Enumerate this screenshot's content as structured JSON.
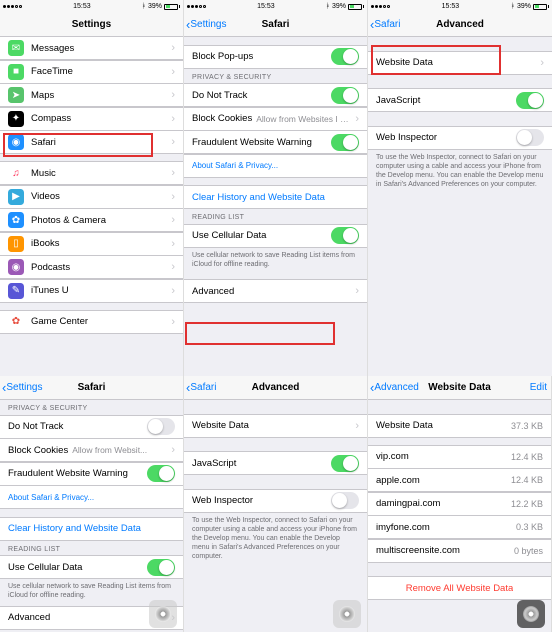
{
  "status": {
    "carrier": "",
    "time": "15:53",
    "battery": "39%"
  },
  "p1": {
    "title": "Settings",
    "items": [
      {
        "label": "Messages",
        "color": "#4cd964",
        "glyph": "✉"
      },
      {
        "label": "FaceTime",
        "color": "#4cd964",
        "glyph": "■"
      },
      {
        "label": "Maps",
        "color": "#58c46c",
        "glyph": "➤"
      },
      {
        "label": "Compass",
        "color": "#000",
        "glyph": "✦"
      },
      {
        "label": "Safari",
        "color": "#1e90ff",
        "glyph": "◉",
        "hi": true
      }
    ],
    "items2": [
      {
        "label": "Music",
        "color": "#fff",
        "glyph": "♫",
        "fg": "#ff2d55"
      },
      {
        "label": "Videos",
        "color": "#34aadc",
        "glyph": "▶"
      },
      {
        "label": "Photos & Camera",
        "color": "#1e90ff",
        "glyph": "✿"
      },
      {
        "label": "iBooks",
        "color": "#ff9500",
        "glyph": "▯"
      },
      {
        "label": "Podcasts",
        "color": "#9b59b6",
        "glyph": "◉"
      },
      {
        "label": "iTunes U",
        "color": "#5856d6",
        "glyph": "✎"
      }
    ],
    "items3": [
      {
        "label": "Game Center",
        "color": "#fff",
        "glyph": "✿",
        "fg": "#e74c3c"
      }
    ]
  },
  "p2": {
    "back": "Settings",
    "title": "Safari",
    "block_popups": "Block Pop-ups",
    "sec_header": "PRIVACY & SECURITY",
    "do_not_track": "Do Not Track",
    "block_cookies": "Block Cookies",
    "block_cookies_val": "Allow from Websites I Visit",
    "fraud": "Fraudulent Website Warning",
    "about": "About Safari & Privacy...",
    "clear": "Clear History and Website Data",
    "rl_header": "READING LIST",
    "cellular": "Use Cellular Data",
    "rl_note": "Use cellular network to save Reading List items from iCloud for offline reading.",
    "advanced": "Advanced"
  },
  "p3": {
    "back": "Safari",
    "title": "Advanced",
    "website_data": "Website Data",
    "javascript": "JavaScript",
    "web_inspector": "Web Inspector",
    "wi_note": "To use the Web Inspector, connect to Safari on your computer using a cable and access your iPhone from the Develop menu. You can enable the Develop menu in Safari's Advanced Preferences on your computer."
  },
  "p4": {
    "back": "Settings",
    "title": "Safari",
    "sec_header": "PRIVACY & SECURITY",
    "do_not_track": "Do Not Track",
    "block_cookies": "Block Cookies",
    "block_cookies_val": "Allow from Websit...",
    "fraud": "Fraudulent Website Warning",
    "about": "About Safari & Privacy...",
    "clear": "Clear History and Website Data",
    "rl_header": "READING LIST",
    "cellular": "Use Cellular Data",
    "rl_note": "Use cellular network to save Reading List items from iCloud for offline reading.",
    "advanced": "Advanced"
  },
  "p5": {
    "back": "Safari",
    "title": "Advanced",
    "website_data": "Website Data",
    "javascript": "JavaScript",
    "web_inspector": "Web Inspector",
    "wi_note": "To use the Web Inspector, connect to Safari on your computer using a cable and access your iPhone from the Develop menu. You can enable the Develop menu in Safari's Advanced Preferences on your computer."
  },
  "p6": {
    "back": "Advanced",
    "title": "Website Data",
    "edit": "Edit",
    "total_label": "Website Data",
    "total_val": "37.3 KB",
    "sites": [
      {
        "name": "vip.com",
        "size": "12.4 KB"
      },
      {
        "name": "apple.com",
        "size": "12.4 KB"
      },
      {
        "name": "damingpai.com",
        "size": "12.2 KB"
      },
      {
        "name": "imyfone.com",
        "size": "0.3 KB"
      },
      {
        "name": "multiscreensite.com",
        "size": "0 bytes"
      }
    ],
    "remove": "Remove All Website Data"
  }
}
